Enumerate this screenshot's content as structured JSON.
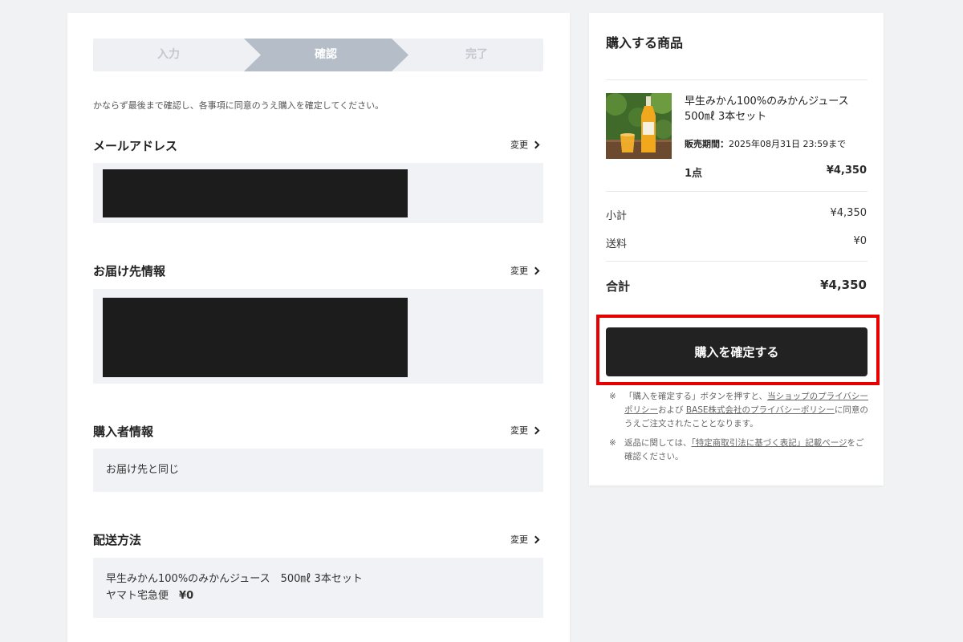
{
  "steps": [
    "入力",
    "確認",
    "完了"
  ],
  "notice": "かならず最後まで確認し、各事項に同意のうえ購入を確定してください。",
  "change_label": "変更",
  "sections": {
    "email": {
      "title": "メールアドレス"
    },
    "shipping": {
      "title": "お届け先情報"
    },
    "purchaser": {
      "title": "購入者情報",
      "value": "お届け先と同じ"
    },
    "delivery": {
      "title": "配送方法",
      "product": "早生みかん100%のみかんジュース　500㎖ 3本セット",
      "method": "ヤマト宅急便",
      "fee": "¥0"
    }
  },
  "summary": {
    "title": "購入する商品",
    "product_name": "早生みかん100%のみかんジュース　500㎖ 3本セット",
    "sale_period_label": "販売期間：",
    "sale_period": "2025年08月31日 23:59まで",
    "qty": "1点",
    "item_price": "¥4,350",
    "subtotal_label": "小計",
    "subtotal": "¥4,350",
    "shipping_label": "送料",
    "shipping": "¥0",
    "total_label": "合計",
    "total": "¥4,350",
    "confirm_button": "購入を確定する"
  },
  "notes": {
    "mark": "※",
    "n1_pre": "「購入を確定する」ボタンを押すと、",
    "n1_link1": "当ショップのプライバシーポリシー",
    "n1_mid": "および",
    "n1_link2": "BASE株式会社のプライバシーポリシー",
    "n1_post": "に同意のうえご注文されたこととなります。",
    "n2_pre": "返品に関しては、",
    "n2_link": "「特定商取引法に基づく表記」記載ページ",
    "n2_post": "をご確認ください。"
  },
  "colors": {
    "step_active": "#b5bdc9",
    "step_bg": "#eef0f3",
    "button": "#222222",
    "highlight": "#e60000"
  }
}
